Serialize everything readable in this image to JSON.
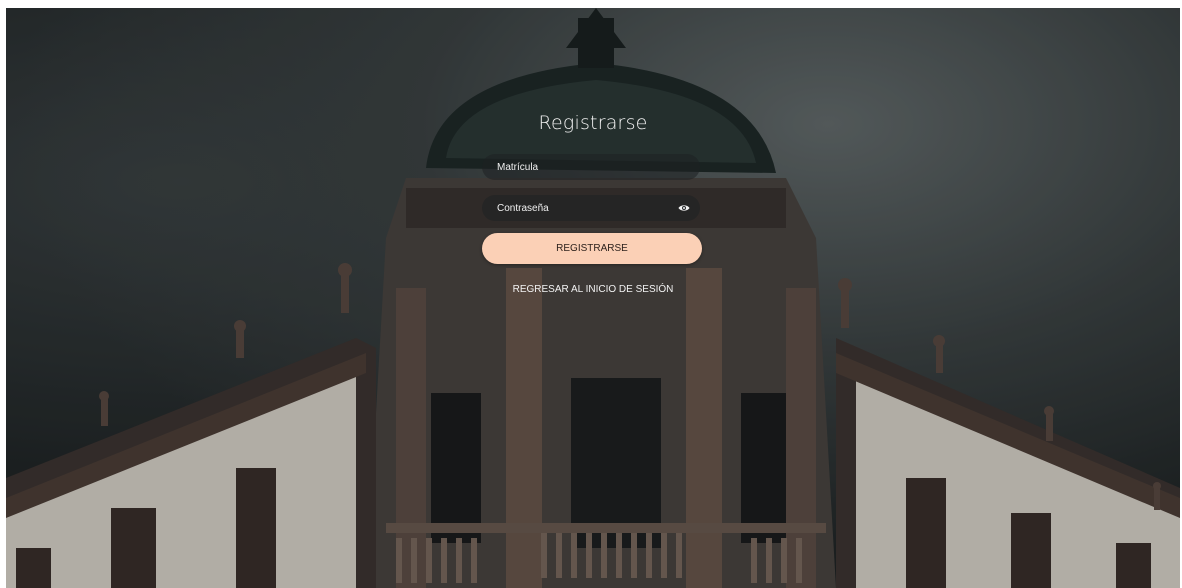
{
  "form": {
    "title": "Registrarse",
    "username_placeholder": "Matrícula",
    "password_placeholder": "Contraseña",
    "submit_label": "REGISTRARSE",
    "back_link": "REGRESAR AL INICIO DE SESIÓN"
  },
  "icons": {
    "password_toggle": "eye-icon"
  },
  "colors": {
    "button_bg": "#fbd0b6",
    "field_bg": "rgba(30,32,34,0.55)",
    "text": "#f2f2f2"
  }
}
